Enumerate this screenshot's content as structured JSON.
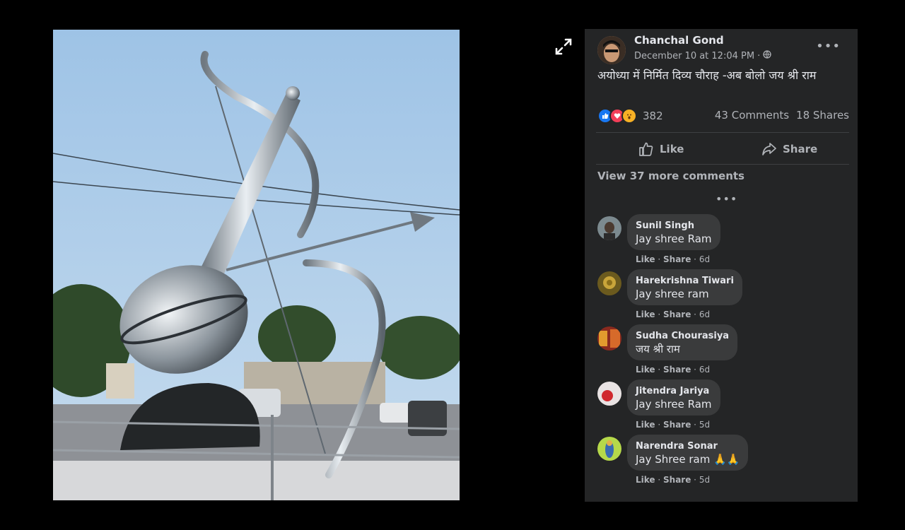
{
  "post": {
    "author": "Chanchal Gond",
    "date": "December 10 at 12:04 PM",
    "separator": "·",
    "text": "अयोध्या में निर्मित दिव्य चौराह -अब बोलो जय श्री राम",
    "more": "•••",
    "reaction_count": "382",
    "comments_count": "43 Comments",
    "shares_count": "18 Shares",
    "reaction_icons": [
      "like-icon",
      "love-icon",
      "wow-icon"
    ]
  },
  "actions": {
    "like": "Like",
    "share": "Share"
  },
  "view_more": "View 37 more comments",
  "more_dots": "•••",
  "colors": {
    "panel_bg": "#242526",
    "bubble_bg": "#3a3b3c",
    "text": "#e4e6eb",
    "muted": "#b0b3b8",
    "like_blue": "#1877f2",
    "love_red": "#f33e58",
    "wow_yellow": "#f7b125"
  },
  "comments": [
    {
      "name": "Sunil Singh",
      "text": "Jay shree Ram",
      "like": "Like",
      "share": "Share",
      "time": "6d"
    },
    {
      "name": "Harekrishna Tiwari",
      "text": "Jay shree ram",
      "like": "Like",
      "share": "Share",
      "time": "6d"
    },
    {
      "name": "Sudha Chourasiya",
      "text": "जय श्री राम",
      "like": "Like",
      "share": "Share",
      "time": "6d"
    },
    {
      "name": "Jitendra Jariya",
      "text": "Jay shree Ram",
      "like": "Like",
      "share": "Share",
      "time": "5d"
    },
    {
      "name": "Narendra Sonar",
      "text": "Jay Shree ram 🙏🙏",
      "like": "Like",
      "share": "Share",
      "time": "5d"
    }
  ]
}
